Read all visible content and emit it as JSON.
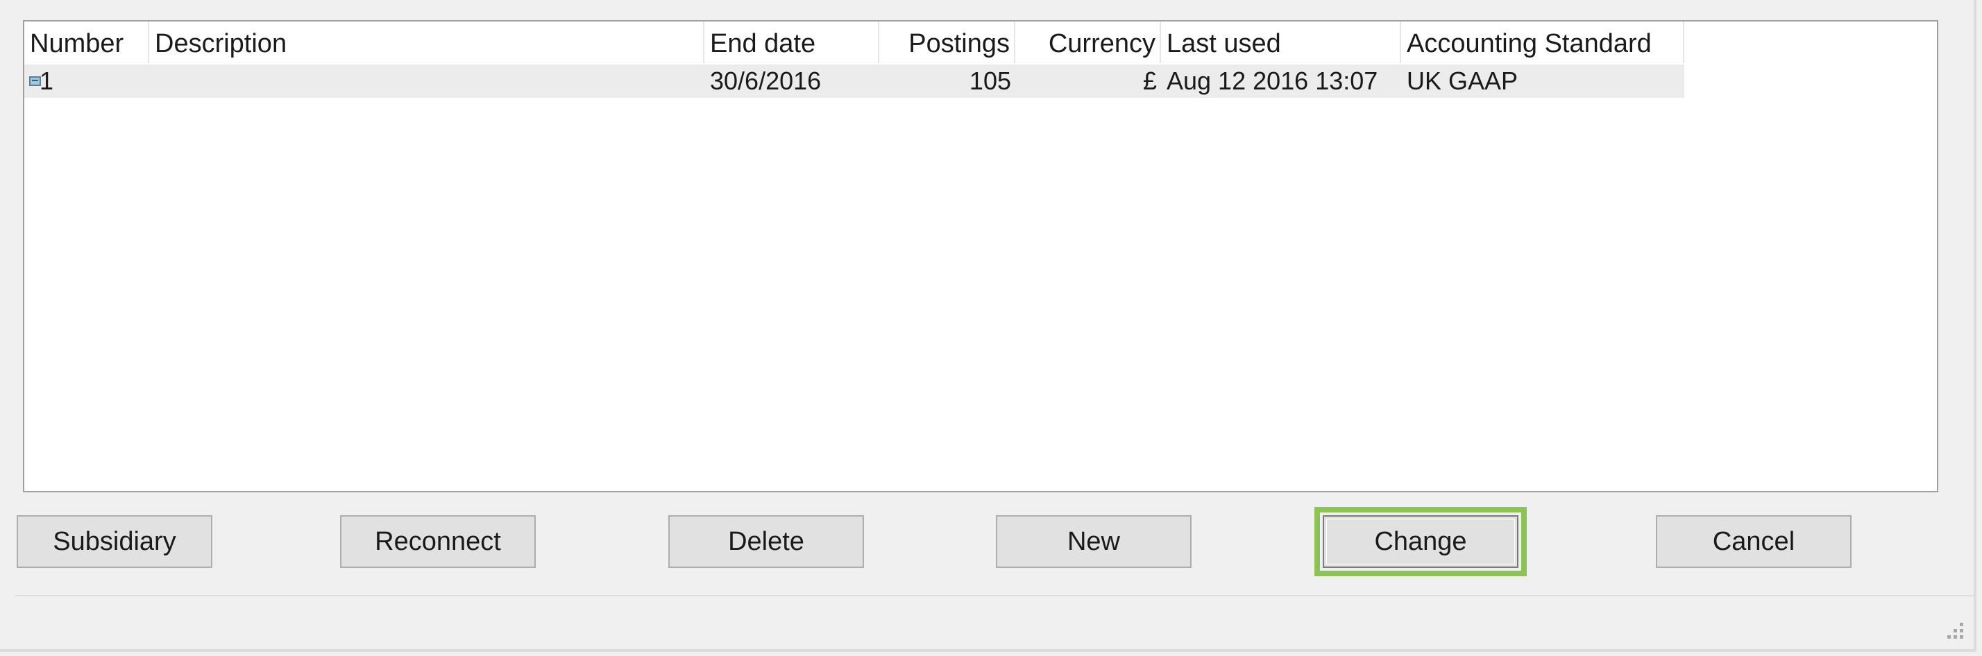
{
  "list": {
    "columns": [
      {
        "label": "Number"
      },
      {
        "label": "Description"
      },
      {
        "label": "End date"
      },
      {
        "label": "Postings"
      },
      {
        "label": "Currency"
      },
      {
        "label": "Last used"
      },
      {
        "label": "Accounting Standard"
      }
    ],
    "rows": [
      {
        "number": "1",
        "description": "",
        "end_date": "30/6/2016",
        "postings": "105",
        "currency": "£",
        "last_used": "Aug 12 2016 13:07",
        "accounting_standard": "UK GAAP",
        "icon": "document-icon"
      }
    ]
  },
  "buttons": {
    "subsidiary": "Subsidiary",
    "reconnect": "Reconnect",
    "delete": "Delete",
    "new": "New",
    "change": "Change",
    "cancel": "Cancel"
  },
  "colors": {
    "focus_highlight": "#8dc356",
    "selected_row": "#ececec"
  }
}
